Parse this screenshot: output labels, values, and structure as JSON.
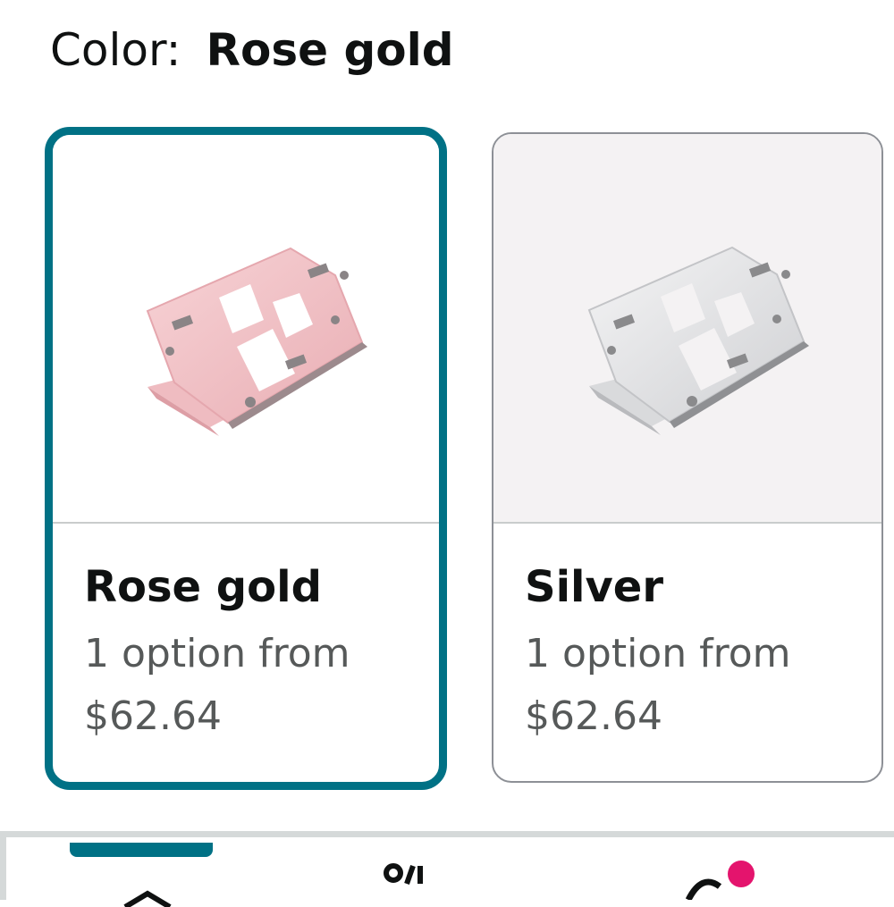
{
  "header": {
    "label": "Color:",
    "selected_value": "Rose gold"
  },
  "swatches": [
    {
      "name": "Rose gold",
      "option_text": "1 option from",
      "price": "$62.64",
      "selected": true,
      "image_icon": "laptop-stand-rose-gold"
    },
    {
      "name": "Silver",
      "option_text": "1 option from",
      "price": "$62.64",
      "selected": false,
      "image_icon": "laptop-stand-silver"
    }
  ],
  "bottom_nav": {
    "icons": [
      "home-icon",
      "you-icon",
      "cart-icon"
    ],
    "badge_color": "#e4146d",
    "accent_color": "#007185"
  },
  "colors": {
    "selected_border": "#007185",
    "unselected_border": "#8d9096",
    "rose_gold": "#f2c2c6",
    "silver": "#dcdcde"
  }
}
